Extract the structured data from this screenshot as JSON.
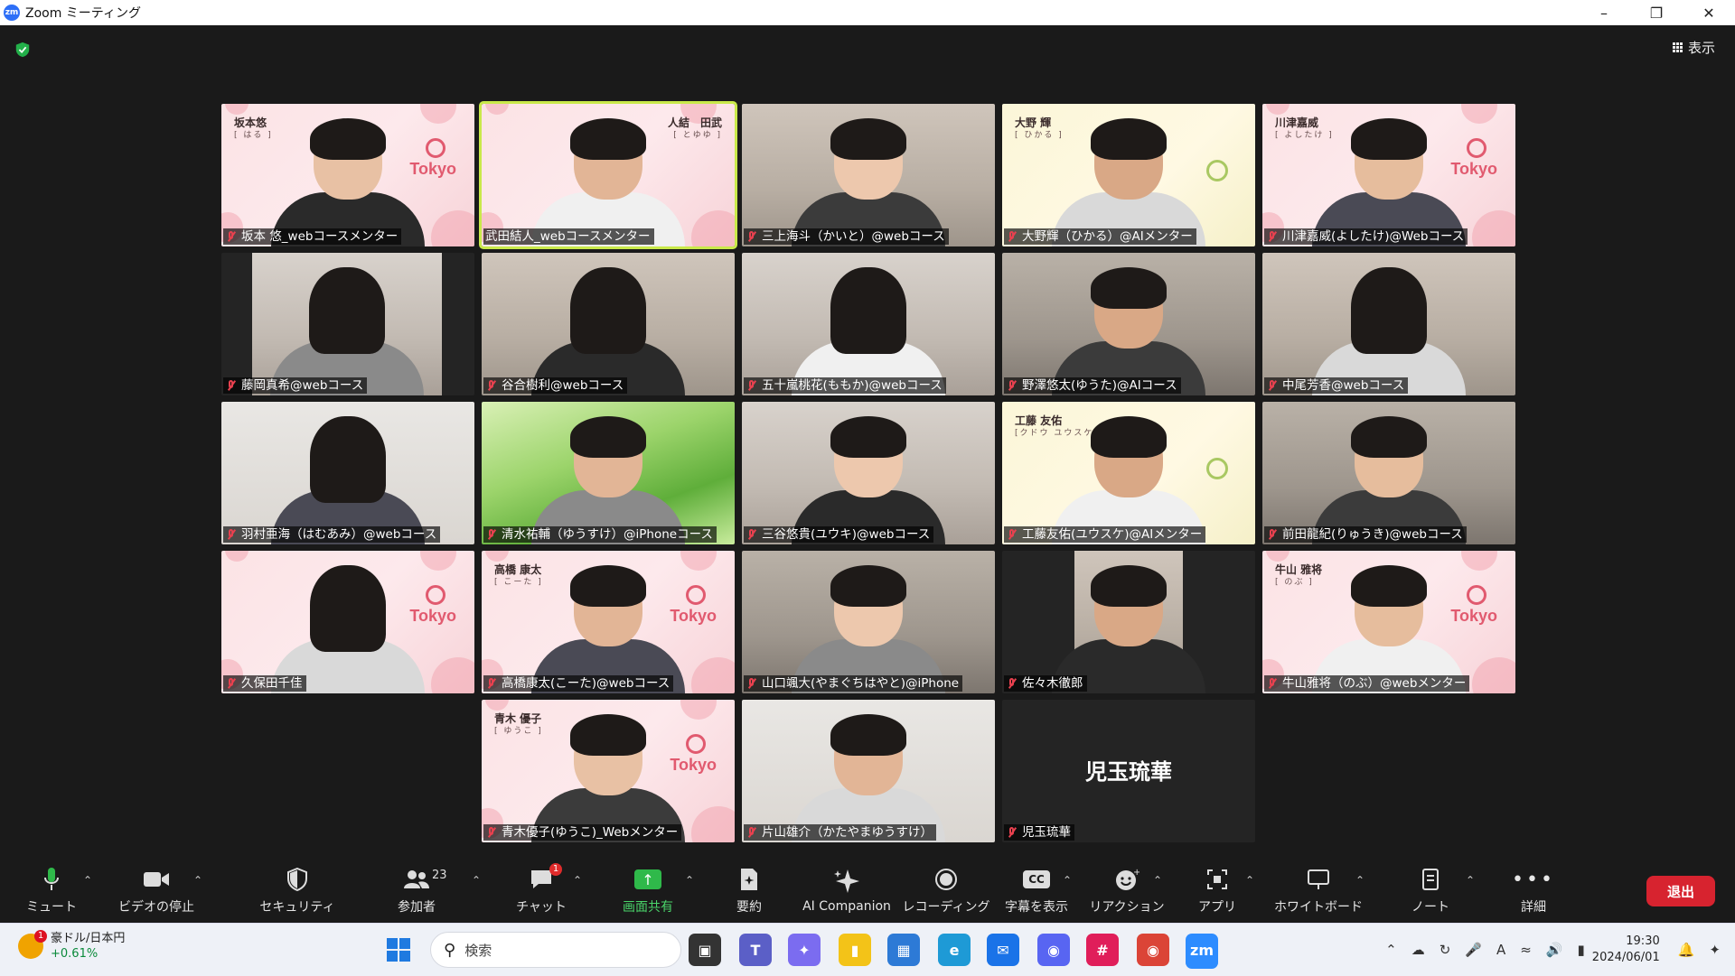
{
  "window": {
    "title": "Zoom ミーティング",
    "logo": "zm"
  },
  "view_button": "表示",
  "participants": [
    {
      "name": "坂本 悠_webコースメンター",
      "bg": "pink",
      "bg_name": "坂本悠",
      "bg_kana": "[ はる ]",
      "tokyo": "Tokyo"
    },
    {
      "name": "武田結人_webコースメンター",
      "bg": "pink",
      "bg_name": "人結　田武",
      "bg_kana": "[ とゆゆ ]",
      "active": true
    },
    {
      "name": "三上海斗（かいと）@webコース",
      "bg": "room"
    },
    {
      "name": "大野輝（ひかる）@AIメンター",
      "bg": "yellow",
      "bg_name": "大野 輝",
      "bg_kana": "[ ひかる ]"
    },
    {
      "name": "川津嘉威(よしたけ)@Webコース",
      "bg": "pink",
      "bg_name": "川津嘉威",
      "bg_kana": "[ よしたけ ]",
      "tokyo": "Tokyo"
    },
    {
      "name": "藤岡真希@webコース",
      "bg": "room2",
      "framed": true
    },
    {
      "name": "谷合樹利@webコース",
      "bg": "room"
    },
    {
      "name": "五十嵐桃花(ももか)@webコース",
      "bg": "room2"
    },
    {
      "name": "野澤悠太(ゆうた)@AIコース",
      "bg": "room3"
    },
    {
      "name": "中尾芳香@webコース",
      "bg": "room"
    },
    {
      "name": "羽村亜海（はむあみ）@webコース",
      "bg": "white"
    },
    {
      "name": "清水祐輔（ゆうすけ）@iPhoneコース",
      "bg": "green"
    },
    {
      "name": "三谷悠貴(ユウキ)@webコース",
      "bg": "room2"
    },
    {
      "name": "工藤友佑(ユウスケ)@AIメンター",
      "bg": "yellow",
      "bg_name": "工藤 友佑",
      "bg_kana": "[クドウ ユウスケ]"
    },
    {
      "name": "前田龍紀(りゅうき)@webコース",
      "bg": "room3"
    },
    {
      "name": "久保田千佳",
      "bg": "pink",
      "tokyo": "Tokyo"
    },
    {
      "name": "高橋康太(こーた)@webコース",
      "bg": "pink",
      "bg_name": "高橋 康太",
      "bg_kana": "[ こーた ]",
      "tokyo": "Tokyo"
    },
    {
      "name": "山口颯大(やまぐちはやと)@iPhone",
      "bg": "room3"
    },
    {
      "name": "佐々木徹郎",
      "bg": "room",
      "framed": true
    },
    {
      "name": "牛山雅将（のぶ）@webメンター",
      "bg": "pink",
      "bg_name": "牛山 雅将",
      "bg_kana": "[ のぶ ]",
      "tokyo": "Tokyo"
    },
    {
      "name": "青木優子(ゆうこ)_Webメンター",
      "bg": "pink",
      "bg_name": "青木 優子",
      "bg_kana": "[ ゆうこ ]",
      "tokyo": "Tokyo"
    },
    {
      "name": "片山雄介（かたやまゆうすけ）",
      "bg": "white"
    },
    {
      "name": "児玉琉華",
      "bg": "dark",
      "big_name": "児玉琉華"
    }
  ],
  "toolbar": {
    "mute": "ミュート",
    "video": "ビデオの停止",
    "security": "セキュリティ",
    "participants": "参加者",
    "participants_count": "23",
    "chat": "チャット",
    "chat_badge": "1",
    "share": "画面共有",
    "summary": "要約",
    "ai_companion": "AI Companion",
    "recording": "レコーディング",
    "captions": "字幕を表示",
    "cc_icon": "CC",
    "reactions": "リアクション",
    "apps": "アプリ",
    "whiteboard": "ホワイトボード",
    "notes": "ノート",
    "more": "詳細",
    "leave": "退出"
  },
  "taskbar": {
    "weather_badge": "1",
    "ticker_name": "豪ドル/日本円",
    "ticker_change": "+0.61%",
    "search_placeholder": "検索",
    "time": "19:30",
    "date": "2024/06/01"
  },
  "colors": {
    "accent_green": "#2fb94a",
    "leave_red": "#d7232f",
    "active_speaker": "#c9e94a",
    "muted_red": "#e8414f"
  }
}
